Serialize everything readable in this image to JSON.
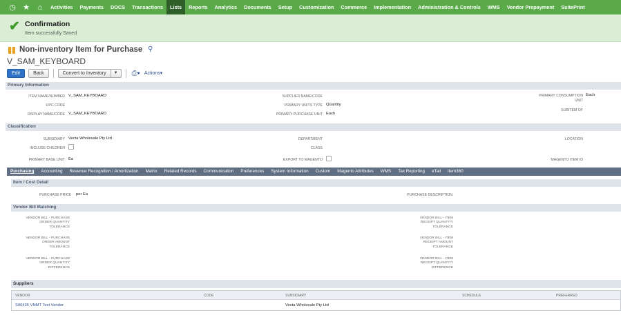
{
  "nav": {
    "icons": [
      "recent-icon",
      "star-icon",
      "home-icon"
    ],
    "items": [
      "Activities",
      "Payments",
      "DOCS",
      "Transactions",
      "Lists",
      "Reports",
      "Analytics",
      "Documents",
      "Setup",
      "Customization",
      "Commerce",
      "Implementation",
      "Administration & Controls",
      "WMS",
      "Vendor Prepayment",
      "SuitePrint"
    ],
    "active": "Lists",
    "color": "#5aaa4a"
  },
  "confirmation": {
    "title": "Confirmation",
    "message": "Item successfully Saved"
  },
  "record": {
    "type": "Non-inventory Item for Purchase",
    "name": "V_SAM_KEYBOARD"
  },
  "toolbar": {
    "edit": "Edit",
    "back": "Back",
    "convert": "Convert to Inventory",
    "actions": "Actions"
  },
  "primary": {
    "header": "Primary Information",
    "item_name_label": "ITEM NAME/NUMBER",
    "item_name": "V_SAM_KEYBOARD",
    "upc_label": "UPC CODE",
    "display_name_label": "DISPLAY NAME/CODE",
    "display_name": "V_SAM_KEYBOARD",
    "supplier_name_label": "SUPPLIER NAME/CODE",
    "units_type_label": "PRIMARY UNITS TYPE",
    "units_type": "Quantity",
    "purchase_unit_label": "PRIMARY PURCHASE UNIT",
    "purchase_unit": "Each",
    "consumption_unit_label_1": "PRIMARY CONSUMPTION",
    "consumption_unit_label_2": "UNIT",
    "consumption_unit": "Each",
    "subitem_label": "SUBITEM OF"
  },
  "classification": {
    "header": "Classification",
    "subsidiary_label": "SUBSIDIARY",
    "subsidiary": "Vecta Wholesale Pty Ltd",
    "include_children_label": "INCLUDE CHILDREN",
    "base_unit_label": "PRIMARY BASE UNIT",
    "base_unit": "Ea",
    "department_label": "DEPARTMENT",
    "class_label": "CLASS",
    "export_label": "EXPORT TO MAGENTO",
    "location_label": "LOCATION",
    "magento_id_label": "MAGENTO ITEM ID"
  },
  "tabs": [
    "Purchasing",
    "Accounting",
    "Revenue Recognition / Amortization",
    "Matrix",
    "Related Records",
    "Communication",
    "Preferences",
    "System Information",
    "Custom",
    "Magento Attributes",
    "WMS",
    "Tax Reporting",
    "eTail",
    "Item360"
  ],
  "purchasing": {
    "cost_header": "Item / Cost Detail",
    "purchase_price_label": "PURCHASE PRICE",
    "purchase_price": "per Ea",
    "purchase_desc_label": "PURCHASE DESCRIPTION",
    "matching_header": "Vendor Bill Matching",
    "left": [
      [
        "VENDOR BILL - PURCHASE",
        "ORDER QUANTITY",
        "TOLERANCE"
      ],
      [
        "VENDOR BILL - PURCHASE",
        "ORDER AMOUNT",
        "TOLERANCE"
      ],
      [
        "VENDOR BILL - PURCHASE",
        "ORDER QUANTITY",
        "DIFFERENCE"
      ]
    ],
    "right": [
      [
        "VENDOR BILL - ITEM",
        "RECEIPT QUANTITY",
        "TOLERANCE"
      ],
      [
        "VENDOR BILL - ITEM",
        "RECEIPT AMOUNT",
        "TOLERANCE"
      ],
      [
        "VENDOR BILL - ITEM",
        "RECEIPT QUANTITY",
        "DIFFERENCE"
      ]
    ]
  },
  "suppliers": {
    "header": "Suppliers",
    "columns": [
      "VENDOR",
      "CODE",
      "SUBSIDIARY",
      "SCHEDULE",
      "PREFERRED"
    ],
    "rows": [
      {
        "vendor": "S00435 VNMT Test Vendor",
        "code": "",
        "subsidiary": "Vecta Wholesale Pty Ltd",
        "schedule": "",
        "preferred": ""
      }
    ]
  }
}
